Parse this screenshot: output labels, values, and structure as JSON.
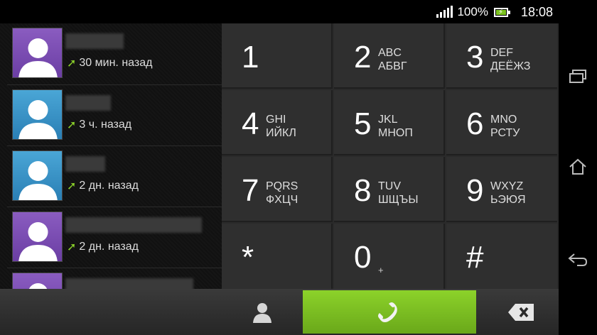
{
  "status": {
    "battery": "100%",
    "time": "18:08"
  },
  "calllog": [
    {
      "avatar_color": "purple",
      "time": "30 мин. назад"
    },
    {
      "avatar_color": "blue",
      "time": "3 ч. назад"
    },
    {
      "avatar_color": "blue",
      "time": "2 дн. назад"
    },
    {
      "avatar_color": "purple",
      "time": "2 дн. назад"
    }
  ],
  "dialpad": {
    "keys": [
      {
        "digit": "1",
        "latin": "",
        "cyrillic": ""
      },
      {
        "digit": "2",
        "latin": "ABC",
        "cyrillic": "АБВГ"
      },
      {
        "digit": "3",
        "latin": "DEF",
        "cyrillic": "ДЕЁЖЗ"
      },
      {
        "digit": "4",
        "latin": "GHI",
        "cyrillic": "ИЙКЛ"
      },
      {
        "digit": "5",
        "latin": "JKL",
        "cyrillic": "МНОП"
      },
      {
        "digit": "6",
        "latin": "MNO",
        "cyrillic": "РСТУ"
      },
      {
        "digit": "7",
        "latin": "PQRS",
        "cyrillic": "ФХЦЧ"
      },
      {
        "digit": "8",
        "latin": "TUV",
        "cyrillic": "ШЩЪЫ"
      },
      {
        "digit": "9",
        "latin": "WXYZ",
        "cyrillic": "ЬЭЮЯ"
      },
      {
        "digit": "*",
        "latin": "",
        "cyrillic": ""
      },
      {
        "digit": "0",
        "latin": "+",
        "cyrillic": ""
      },
      {
        "digit": "#",
        "latin": "",
        "cyrillic": ""
      }
    ]
  },
  "icons": {
    "contacts": "person-icon",
    "call": "phone-handset-icon",
    "backspace": "backspace-icon",
    "recent_apps": "recent-apps-icon",
    "home": "home-icon",
    "back": "back-icon"
  },
  "colors": {
    "call_green": "#7cc41f",
    "arrow_green": "#8bd12a"
  }
}
